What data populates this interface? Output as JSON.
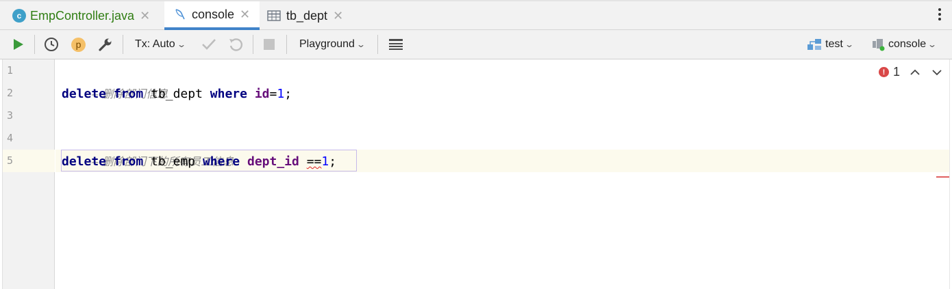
{
  "tabs": [
    {
      "label": "EmpController.java",
      "icon": "c",
      "close": "✕"
    },
    {
      "label": "console",
      "close": "✕"
    },
    {
      "label": "tb_dept",
      "close": "✕"
    }
  ],
  "toolbar": {
    "tx_label": "Tx: Auto",
    "playground_label": "Playground",
    "datasource_label": "test",
    "session_label": "console",
    "p_badge": "p"
  },
  "editor": {
    "line_numbers": [
      "1",
      "2",
      "3",
      "4",
      "5"
    ],
    "comments": {
      "line1": "-- 删除部门信息",
      "line4": "-- 删除部门下的所有员工信息"
    },
    "line2": {
      "kw1": "delete",
      "kw2": "from",
      "table": "tb_dept",
      "kw3": "where",
      "col": "id",
      "op": "=",
      "num": "1",
      "end": ";"
    },
    "line5": {
      "kw1": "delete",
      "kw2": "from",
      "table": "tb_emp",
      "kw3": "where",
      "col": "dept_id",
      "op": "==",
      "num": "1",
      "end": ";"
    },
    "error_count": "1",
    "error_glyph": "!"
  },
  "colors": {
    "keyword": "#000080",
    "column": "#660e7a",
    "number": "#0000ff",
    "comment": "#8c8c8c",
    "active_tab_underline": "#4083c9",
    "run_green": "#3a9a3a"
  }
}
